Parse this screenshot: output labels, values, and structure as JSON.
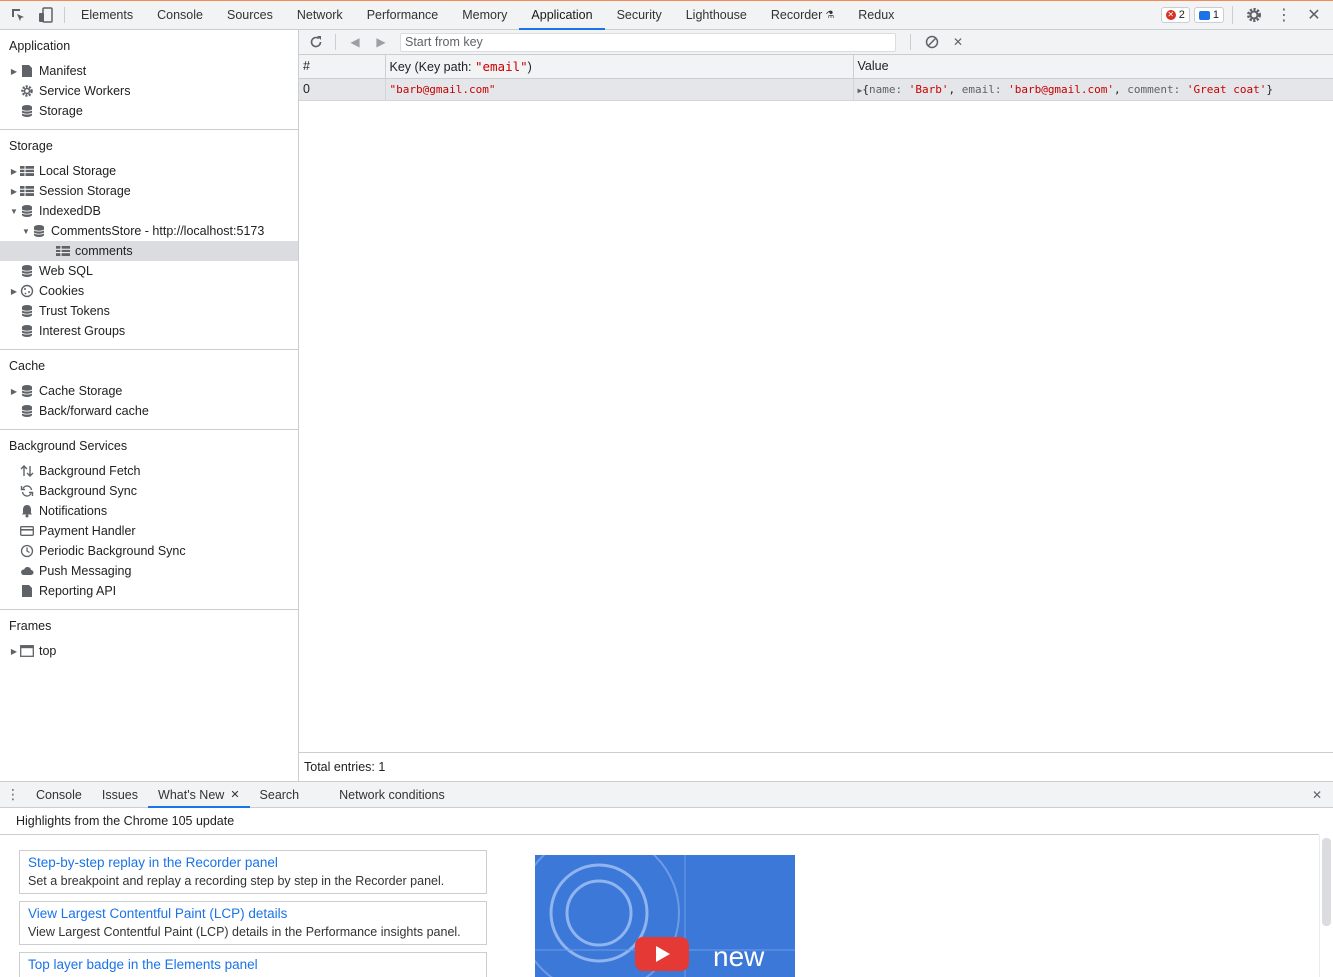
{
  "top_tabs": [
    "Elements",
    "Console",
    "Sources",
    "Network",
    "Performance",
    "Memory",
    "Application",
    "Security",
    "Lighthouse",
    "Recorder",
    "Redux"
  ],
  "active_top_tab": "Application",
  "badges": {
    "errors": "2",
    "messages": "1"
  },
  "sidebar": {
    "application": {
      "title": "Application",
      "items": [
        "Manifest",
        "Service Workers",
        "Storage"
      ]
    },
    "storage": {
      "title": "Storage",
      "items": [
        "Local Storage",
        "Session Storage",
        "IndexedDB",
        "CommentsStore - http://localhost:5173",
        "comments",
        "Web SQL",
        "Cookies",
        "Trust Tokens",
        "Interest Groups"
      ]
    },
    "cache": {
      "title": "Cache",
      "items": [
        "Cache Storage",
        "Back/forward cache"
      ]
    },
    "background": {
      "title": "Background Services",
      "items": [
        "Background Fetch",
        "Background Sync",
        "Notifications",
        "Payment Handler",
        "Periodic Background Sync",
        "Push Messaging",
        "Reporting API"
      ]
    },
    "frames": {
      "title": "Frames",
      "items": [
        "top"
      ]
    }
  },
  "toolbar": {
    "start_placeholder": "Start from key"
  },
  "table": {
    "headers": {
      "index": "#",
      "key_prefix": "Key (Key path: ",
      "key_path": "\"email\"",
      "key_suffix": ")",
      "value": "Value"
    },
    "rows": [
      {
        "index": "0",
        "key": "\"barb@gmail.com\"",
        "value": {
          "open": "{",
          "name_k": "name",
          "name_v": "'Barb'",
          "email_k": "email",
          "email_v": "'barb@gmail.com'",
          "comment_k": "comment",
          "comment_v": "'Great coat'",
          "close": "}"
        }
      }
    ]
  },
  "total_entries": "Total entries: 1",
  "drawer": {
    "tabs": [
      "Console",
      "Issues",
      "What's New",
      "Search",
      "Network conditions"
    ],
    "active_tab": "What's New",
    "header": "Highlights from the Chrome 105 update",
    "features": [
      {
        "title": "Step-by-step replay in the Recorder panel",
        "desc": "Set a breakpoint and replay a recording step by step in the Recorder panel."
      },
      {
        "title": "View Largest Contentful Paint (LCP) details",
        "desc": "View Largest Contentful Paint (LCP) details in the Performance insights panel."
      },
      {
        "title": "Top layer badge in the Elements panel",
        "desc": ""
      }
    ],
    "video_text": "new"
  }
}
